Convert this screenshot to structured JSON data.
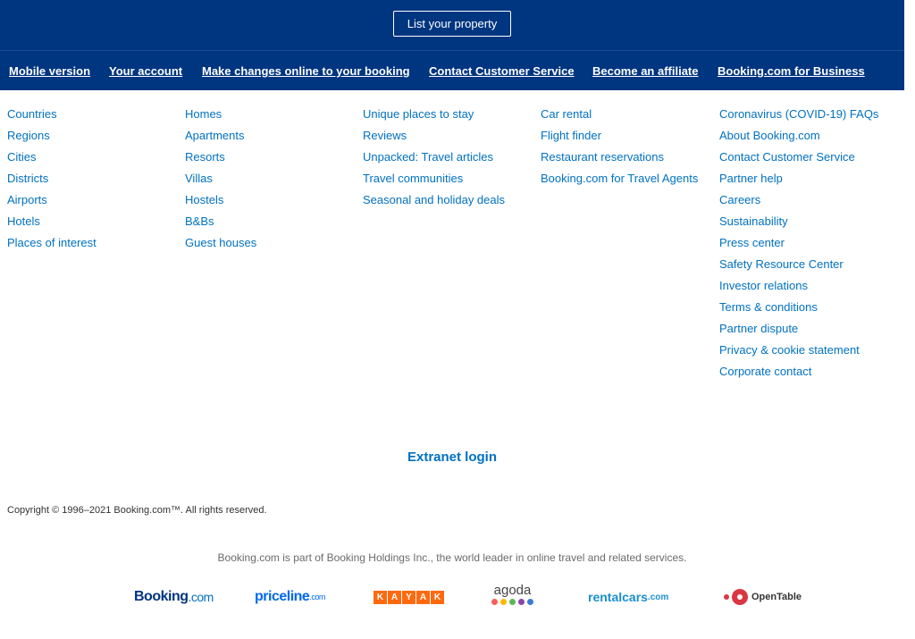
{
  "header": {
    "list_property_label": "List your property"
  },
  "nav": {
    "items": [
      "Mobile version",
      "Your account",
      "Make changes online to your booking",
      "Contact Customer Service",
      "Become an affiliate",
      "Booking.com for Business"
    ]
  },
  "columns": {
    "col1": [
      "Countries",
      "Regions",
      "Cities",
      "Districts",
      "Airports",
      "Hotels",
      "Places of interest"
    ],
    "col2": [
      "Homes",
      "Apartments",
      "Resorts",
      "Villas",
      "Hostels",
      "B&Bs",
      "Guest houses"
    ],
    "col3": [
      "Unique places to stay",
      "Reviews",
      "Unpacked: Travel articles",
      "Travel communities",
      "Seasonal and holiday deals"
    ],
    "col4": [
      "Car rental",
      "Flight finder",
      "Restaurant reservations",
      "Booking.com for Travel Agents"
    ],
    "col5": [
      "Coronavirus (COVID-19) FAQs",
      "About Booking.com",
      "Contact Customer Service",
      "Partner help",
      "Careers",
      "Sustainability",
      "Press center",
      "Safety Resource Center",
      "Investor relations",
      "Terms & conditions",
      "Partner dispute",
      "Privacy & cookie statement",
      "Corporate contact"
    ]
  },
  "extranet_label": "Extranet login",
  "copyright": "Copyright © 1996–2021 Booking.com™. All rights reserved.",
  "holdings_text": "Booking.com is part of Booking Holdings Inc., the world leader in online travel and related services.",
  "brands": {
    "booking": {
      "name": "Booking",
      "suffix": ".com"
    },
    "priceline": {
      "name": "priceline",
      "suffix": ".com"
    },
    "kayak": [
      "K",
      "A",
      "Y",
      "A",
      "K"
    ],
    "agoda": {
      "name": "agoda",
      "dot_colors": [
        "#ff5d5d",
        "#ffb800",
        "#5cb85c",
        "#8e44ad",
        "#3a7bd5"
      ]
    },
    "rentalcars": {
      "name": "rentalcars",
      "suffix": ".com"
    },
    "opentable": {
      "name": "OpenTable"
    }
  },
  "colors": {
    "brand_blue": "#003580",
    "link_blue": "#0071c2"
  }
}
